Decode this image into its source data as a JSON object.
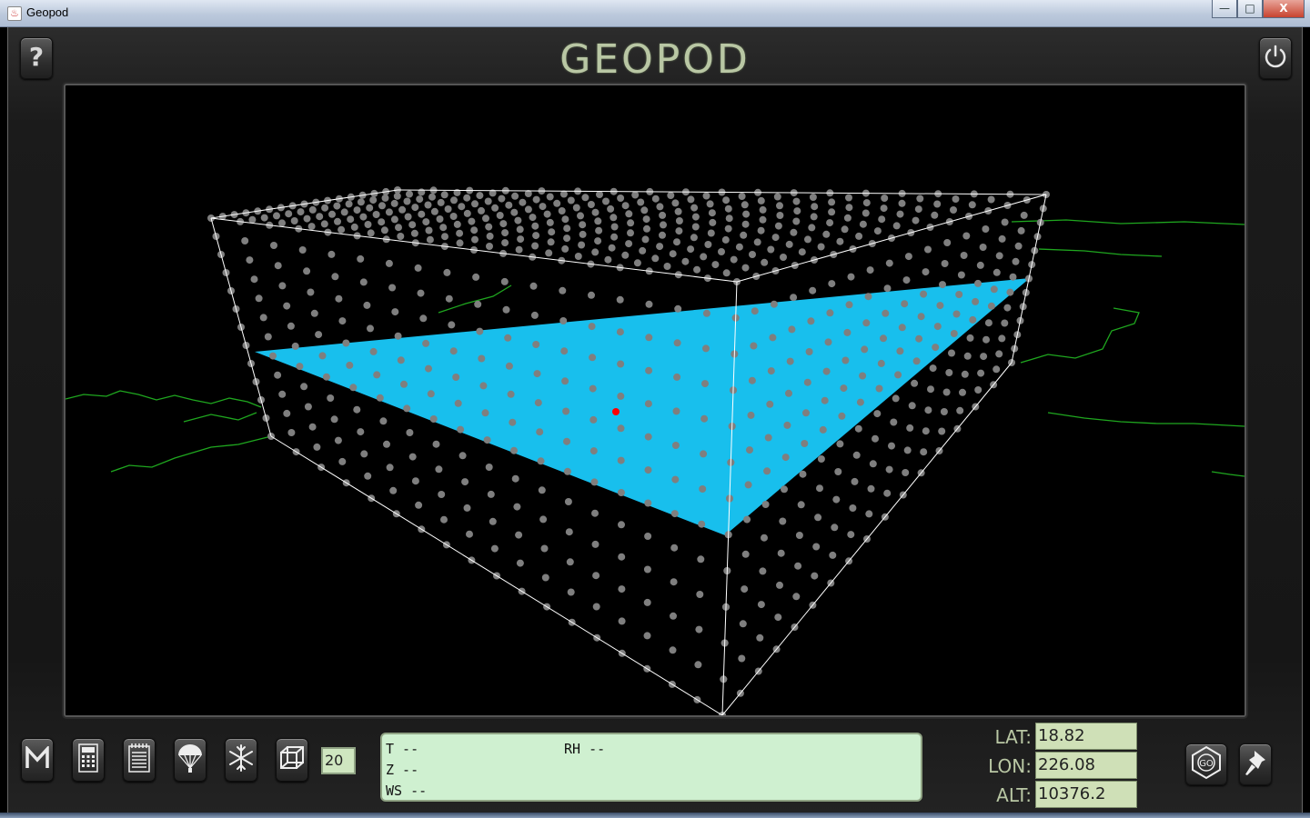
{
  "window": {
    "title": "Geopod",
    "minimize": "—",
    "maximize": "□",
    "close": "X"
  },
  "header": {
    "logo": "GEOPOD"
  },
  "toolbar": {
    "level_value": "20"
  },
  "readout": {
    "t": "T --",
    "rh": "RH --",
    "z": "Z --",
    "ws": "WS --"
  },
  "coords": {
    "lat_label": "LAT:",
    "lat_value": "18.82",
    "lon_label": "LON:",
    "lon_value": "226.08",
    "alt_label": "ALT:",
    "alt_value": "10376.2"
  },
  "colors": {
    "isosurface": "#19c5f5",
    "grid_points": "#7f7f7f",
    "map_lines": "#1fa71f",
    "pod_marker": "#ff0000",
    "bounding_box": "#ffffff"
  },
  "icons": [
    "help-icon",
    "power-icon",
    "menu-m-icon",
    "calculator-icon",
    "notepad-icon",
    "dropsonde-parachute-icon",
    "snowflake-icon",
    "cube-icon",
    "go-icon",
    "pushpin-icon"
  ]
}
